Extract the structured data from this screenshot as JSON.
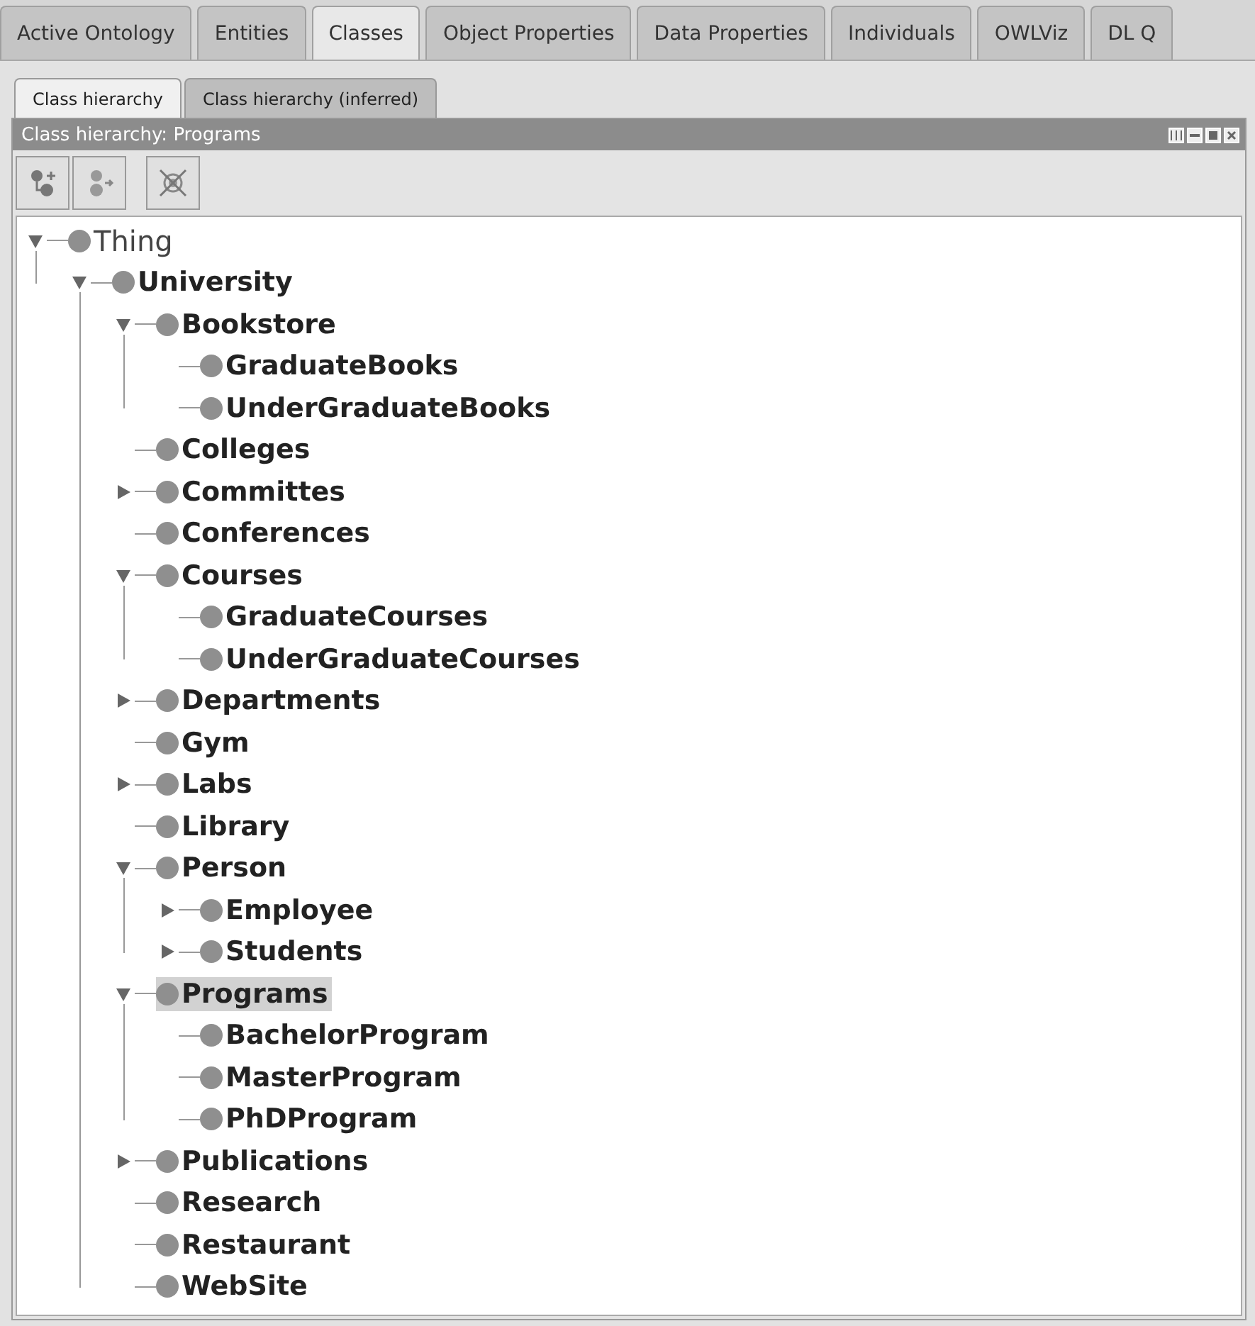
{
  "main_tabs": [
    {
      "label": "Active Ontology",
      "selected": false
    },
    {
      "label": "Entities",
      "selected": false
    },
    {
      "label": "Classes",
      "selected": true
    },
    {
      "label": "Object Properties",
      "selected": false
    },
    {
      "label": "Data Properties",
      "selected": false
    },
    {
      "label": "Individuals",
      "selected": false
    },
    {
      "label": "OWLViz",
      "selected": false
    },
    {
      "label": "DL Q",
      "selected": false
    }
  ],
  "sub_tabs": [
    {
      "label": "Class hierarchy",
      "selected": true
    },
    {
      "label": "Class hierarchy (inferred)",
      "selected": false
    }
  ],
  "panel": {
    "title": "Class hierarchy: Programs"
  },
  "tree": [
    {
      "label": "Thing",
      "kind": "root",
      "expanded": true,
      "selected": false,
      "children": [
        {
          "label": "University",
          "kind": "branch",
          "expanded": true,
          "selected": false,
          "children": [
            {
              "label": "Bookstore",
              "kind": "branch",
              "expanded": true,
              "selected": false,
              "children": [
                {
                  "label": "GraduateBooks",
                  "kind": "leaf",
                  "selected": false
                },
                {
                  "label": "UnderGraduateBooks",
                  "kind": "leaf",
                  "selected": false
                }
              ]
            },
            {
              "label": "Colleges",
              "kind": "leaf",
              "selected": false
            },
            {
              "label": "Committes",
              "kind": "branch",
              "expanded": false,
              "selected": false
            },
            {
              "label": "Conferences",
              "kind": "leaf",
              "selected": false
            },
            {
              "label": "Courses",
              "kind": "branch",
              "expanded": true,
              "selected": false,
              "children": [
                {
                  "label": "GraduateCourses",
                  "kind": "leaf",
                  "selected": false
                },
                {
                  "label": "UnderGraduateCourses",
                  "kind": "leaf",
                  "selected": false
                }
              ]
            },
            {
              "label": "Departments",
              "kind": "branch",
              "expanded": false,
              "selected": false
            },
            {
              "label": "Gym",
              "kind": "leaf",
              "selected": false
            },
            {
              "label": "Labs",
              "kind": "branch",
              "expanded": false,
              "selected": false
            },
            {
              "label": "Library",
              "kind": "leaf",
              "selected": false
            },
            {
              "label": "Person",
              "kind": "branch",
              "expanded": true,
              "selected": false,
              "children": [
                {
                  "label": "Employee",
                  "kind": "branch",
                  "expanded": false,
                  "selected": false
                },
                {
                  "label": "Students",
                  "kind": "branch",
                  "expanded": false,
                  "selected": false
                }
              ]
            },
            {
              "label": "Programs",
              "kind": "branch",
              "expanded": true,
              "selected": true,
              "children": [
                {
                  "label": "BachelorProgram",
                  "kind": "leaf",
                  "selected": false
                },
                {
                  "label": "MasterProgram",
                  "kind": "leaf",
                  "selected": false
                },
                {
                  "label": "PhDProgram",
                  "kind": "leaf",
                  "selected": false
                }
              ]
            },
            {
              "label": "Publications",
              "kind": "branch",
              "expanded": false,
              "selected": false
            },
            {
              "label": "Research",
              "kind": "leaf",
              "selected": false
            },
            {
              "label": "Restaurant",
              "kind": "leaf",
              "selected": false
            },
            {
              "label": "WebSite",
              "kind": "leaf",
              "selected": false
            }
          ]
        }
      ]
    }
  ]
}
